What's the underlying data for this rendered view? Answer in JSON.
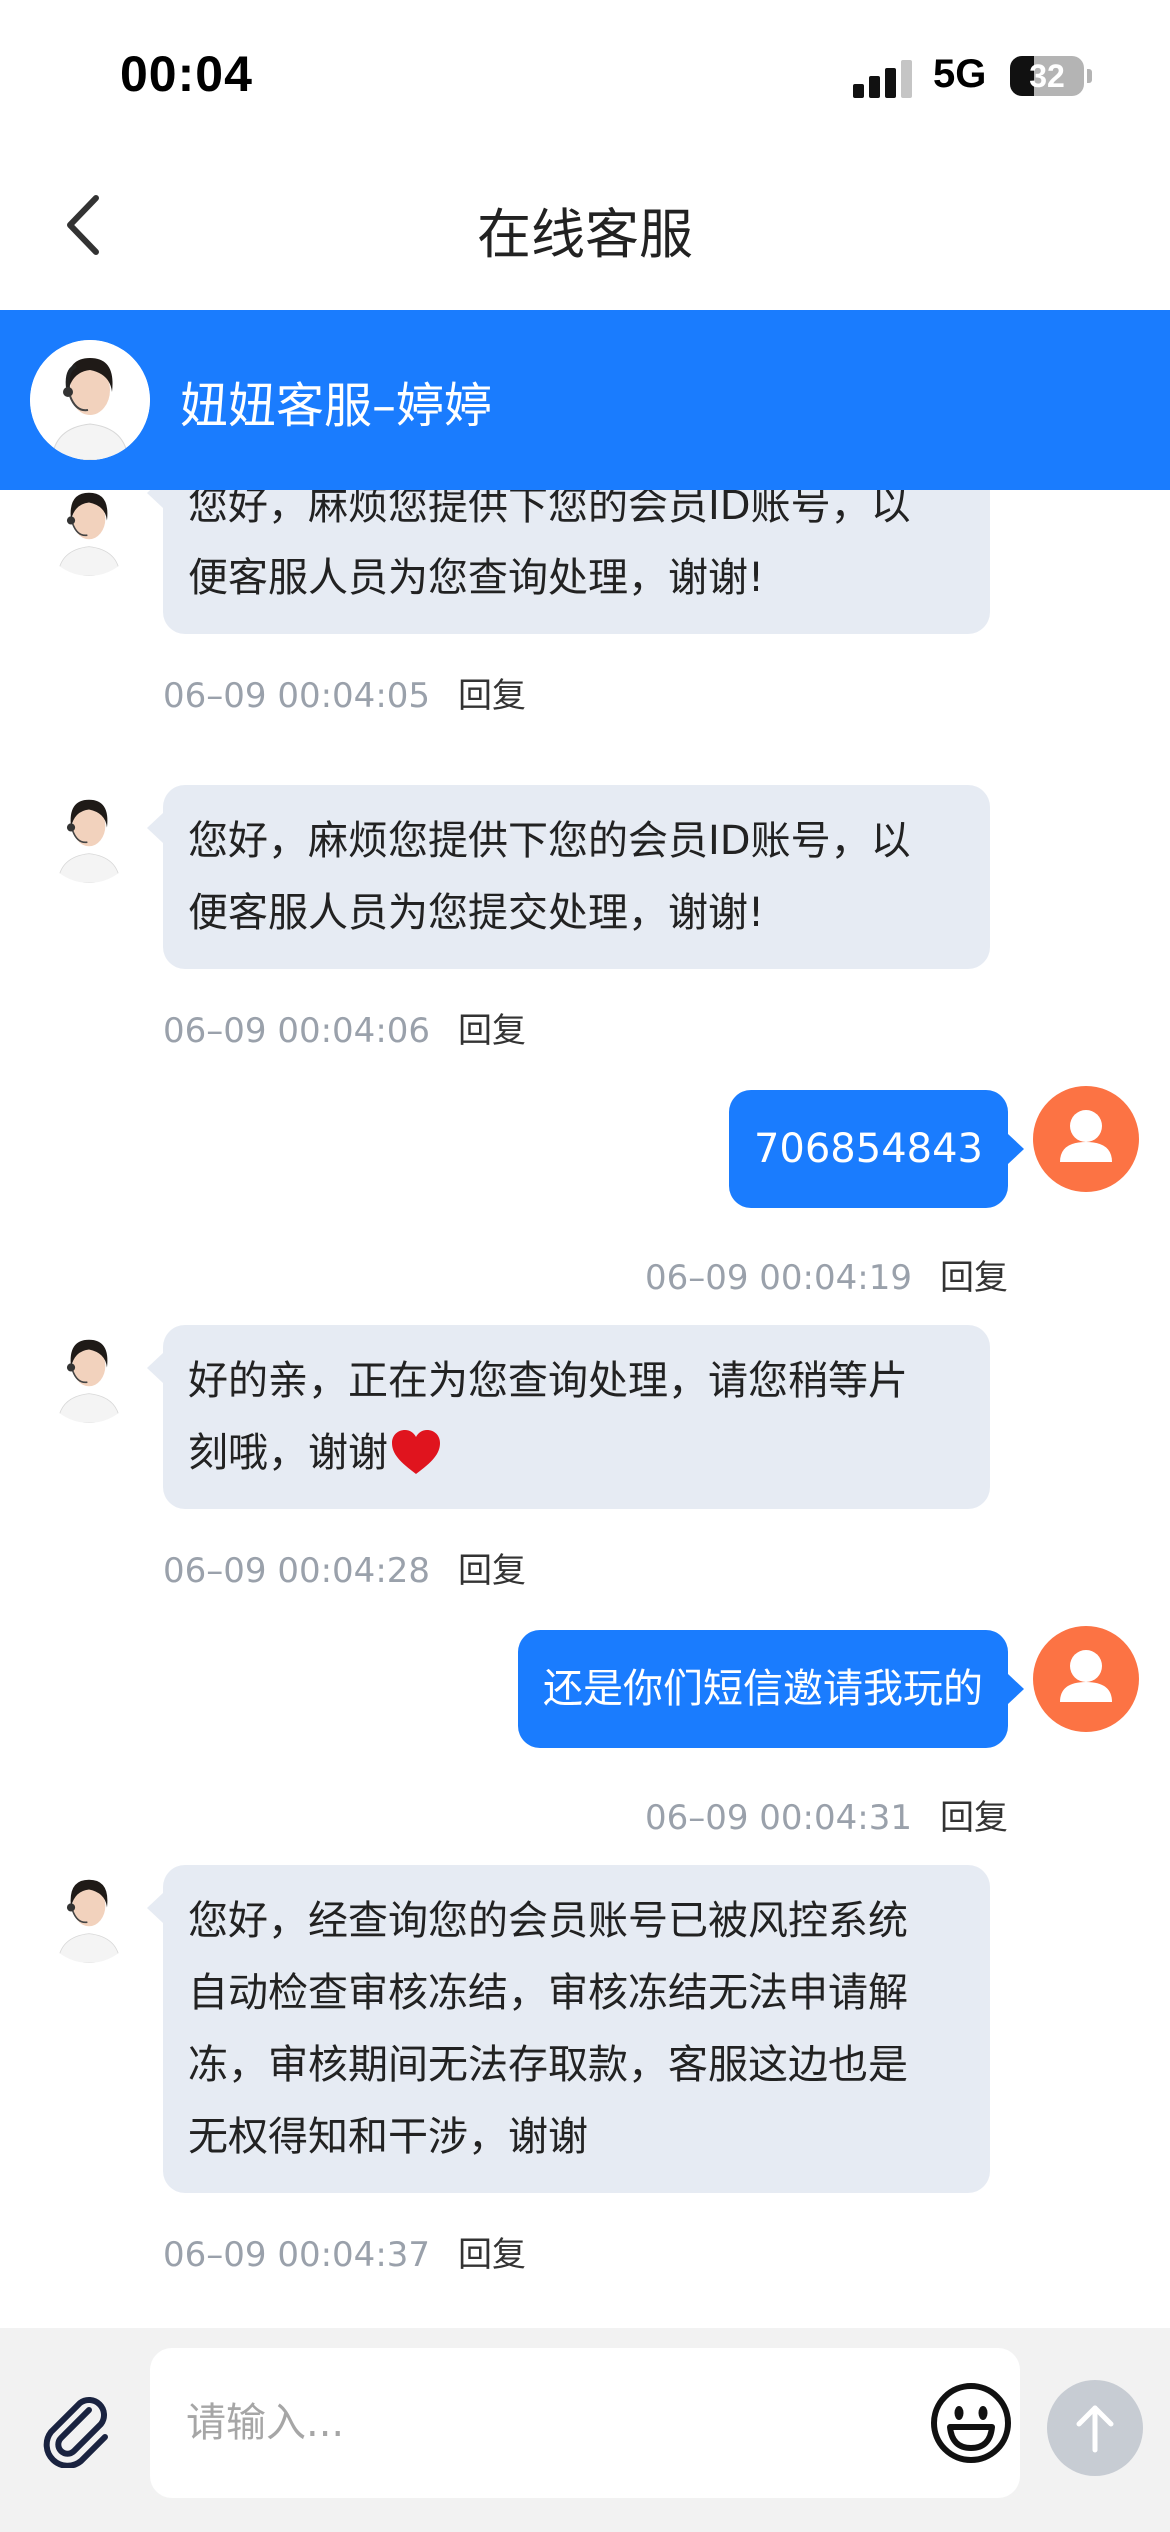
{
  "status_bar": {
    "time": "00:04",
    "network": "5G",
    "battery_level": "32",
    "battery_fraction": 0.32
  },
  "nav": {
    "title": "在线客服"
  },
  "agent": {
    "name": "妞妞客服–婷婷"
  },
  "colors": {
    "primary": "#1a7cfe",
    "user_avatar": "#fc7344",
    "incoming_bubble": "#e6ebf3"
  },
  "reply_label": "回复",
  "messages": [
    {
      "from": "agent",
      "lines": [
        "您好，麻烦您提供下您的会员ID账号，以",
        "便客服人员为您查询处理，谢谢!"
      ],
      "time": "06–09 00:04:05"
    },
    {
      "from": "agent",
      "lines": [
        "您好，麻烦您提供下您的会员ID账号，以",
        "便客服人员为您提交处理，谢谢!"
      ],
      "time": "06–09 00:04:06"
    },
    {
      "from": "user",
      "text": "706854843",
      "time": "06–09 00:04:19"
    },
    {
      "from": "agent",
      "lines": [
        "好的亲，正在为您查询处理，请您稍等片",
        "刻哦，谢谢"
      ],
      "time": "06–09 00:04:28",
      "emoji": "heart"
    },
    {
      "from": "user",
      "text": "还是你们短信邀请我玩的",
      "time": "06–09 00:04:31"
    },
    {
      "from": "agent",
      "lines": [
        "您好，经查询您的会员账号已被风控系统",
        "自动检查审核冻结，审核冻结无法申请解",
        "冻，审核期间无法存取款，客服这边也是",
        "无权得知和干涉，谢谢"
      ],
      "time": "06–09 00:04:37"
    }
  ],
  "input": {
    "placeholder": "请输入..."
  }
}
